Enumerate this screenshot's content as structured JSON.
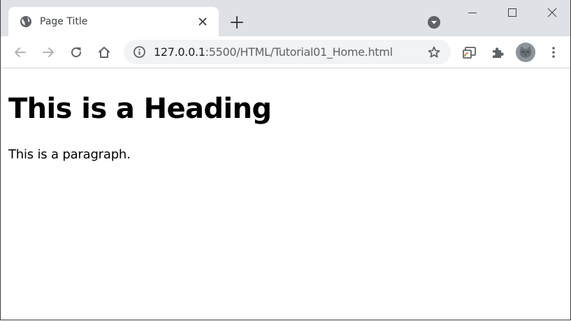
{
  "browser": {
    "tab": {
      "title": "Page Title",
      "favicon": "globe-icon"
    },
    "new_tab_icon": "plus-icon",
    "tab_search_icon": "chevron-down-circle-icon",
    "window_controls": [
      "minimize-icon",
      "maximize-icon",
      "close-icon"
    ],
    "toolbar": {
      "back_icon": "arrow-left-icon",
      "forward_icon": "arrow-right-icon",
      "reload_icon": "reload-icon",
      "home_icon": "home-icon",
      "info_icon": "info-icon",
      "url_host": "127.0.0.1",
      "url_rest": ":5500/HTML/Tutorial01_Home.html",
      "bookmark_icon": "star-icon",
      "cast_icon": "cast-icon",
      "extensions_icon": "puzzle-icon",
      "profile_icon": "avatar",
      "menu_icon": "kebab-menu-icon"
    },
    "colors": {
      "tabstrip_bg": "#dee1e6",
      "omnibox_bg": "#f1f3f4",
      "icon": "#5f6368"
    }
  },
  "page": {
    "heading": "This is a Heading",
    "paragraph": "This is a paragraph."
  }
}
